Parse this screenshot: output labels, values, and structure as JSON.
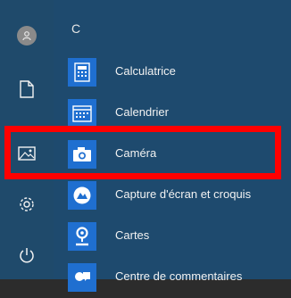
{
  "left_rail": {
    "items": [
      {
        "icon": "user-avatar-icon"
      },
      {
        "icon": "document-icon"
      },
      {
        "icon": "pictures-icon"
      },
      {
        "icon": "settings-gear-icon"
      },
      {
        "icon": "power-icon"
      }
    ]
  },
  "app_list": {
    "section_letter": "C",
    "items": [
      {
        "label": "Calculatrice",
        "icon": "calculator-icon"
      },
      {
        "label": "Calendrier",
        "icon": "calendar-icon"
      },
      {
        "label": "Caméra",
        "icon": "camera-icon"
      },
      {
        "label": "Capture d'écran et croquis",
        "icon": "snip-sketch-icon"
      },
      {
        "label": "Cartes",
        "icon": "maps-icon"
      },
      {
        "label": "Centre de commentaires",
        "icon": "feedback-hub-icon"
      }
    ]
  },
  "highlight_color": "#ff0000",
  "tile_color": "#1f6fd0"
}
